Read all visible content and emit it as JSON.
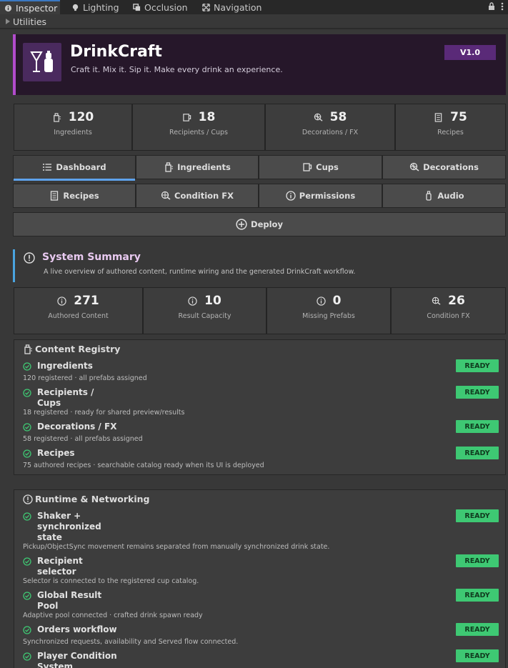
{
  "top_tabs": [
    {
      "label": "Inspector",
      "icon": "info-icon"
    },
    {
      "label": "Lighting",
      "icon": "bulb-icon"
    },
    {
      "label": "Occlusion",
      "icon": "occlusion-icon"
    },
    {
      "label": "Navigation",
      "icon": "navigation-icon"
    }
  ],
  "utilities_label": "Utilities",
  "app": {
    "title": "DrinkCraft",
    "tagline": "Craft it. Mix it. Sip it. Make every drink an experience.",
    "version": "V1.0",
    "accent": "#b24ccc"
  },
  "stats": [
    {
      "value": "120",
      "label": "Ingredients",
      "icon": "bottle-icon"
    },
    {
      "value": "18",
      "label": "Recipients / Cups",
      "icon": "cup-icon"
    },
    {
      "value": "58",
      "label": "Decorations / FX",
      "icon": "decoration-icon"
    },
    {
      "value": "75",
      "label": "Recipes",
      "icon": "recipe-icon"
    }
  ],
  "tabs_row1": [
    {
      "label": "Dashboard",
      "icon": "list-icon"
    },
    {
      "label": "Ingredients",
      "icon": "bottle-icon"
    },
    {
      "label": "Cups",
      "icon": "cup-icon"
    },
    {
      "label": "Decorations",
      "icon": "decoration-icon"
    }
  ],
  "tabs_row2": [
    {
      "label": "Recipes",
      "icon": "recipe-icon"
    },
    {
      "label": "Condition FX",
      "icon": "fx-icon"
    },
    {
      "label": "Permissions",
      "icon": "info-icon"
    },
    {
      "label": "Audio",
      "icon": "audio-icon"
    }
  ],
  "deploy_label": "Deploy",
  "summary": {
    "title": "System Summary",
    "subtitle": "A live overview of authored content, runtime wiring and the generated DrinkCraft workflow."
  },
  "summary_stats": [
    {
      "value": "271",
      "label": "Authored Content",
      "icon": "info-icon"
    },
    {
      "value": "10",
      "label": "Result Capacity",
      "icon": "info-icon"
    },
    {
      "value": "0",
      "label": "Missing Prefabs",
      "icon": "info-icon"
    },
    {
      "value": "26",
      "label": "Condition FX",
      "icon": "fx-icon"
    }
  ],
  "registry": {
    "title": "Content Registry",
    "items": [
      {
        "label1": "Ingredients",
        "label2": "",
        "desc": "120 registered · all prefabs assigned",
        "status": "READY"
      },
      {
        "label1": "Recipients /",
        "label2": "Cups",
        "desc": "18 registered · ready for shared preview/results",
        "status": "READY"
      },
      {
        "label1": "Decorations / FX",
        "label2": "",
        "desc": "58 registered · all prefabs assigned",
        "status": "READY"
      },
      {
        "label1": "Recipes",
        "label2": "",
        "desc": "75 authored recipes · searchable catalog ready when its UI is deployed",
        "status": "READY"
      }
    ]
  },
  "runtime": {
    "title": "Runtime & Networking",
    "items": [
      {
        "label1": "Shaker +",
        "label2": "synchronized",
        "label3": "state",
        "desc": "Pickup/ObjectSync movement remains separated from manually synchronized drink state.",
        "status": "READY"
      },
      {
        "label1": "Recipient",
        "label2": "selector",
        "label3": "",
        "desc": "Selector is connected to the registered cup catalog.",
        "status": "READY"
      },
      {
        "label1": "Global Result",
        "label2": "Pool",
        "label3": "",
        "desc": "Adaptive pool connected · crafted drink spawn ready",
        "status": "READY"
      },
      {
        "label1": "Orders workflow",
        "label2": "",
        "label3": "",
        "desc": "Synchronized requests, availability and Served flow connected.",
        "status": "READY"
      },
      {
        "label1": "Player Condition",
        "label2": "System",
        "label3": "",
        "desc": "",
        "status": "READY"
      }
    ]
  },
  "colors": {
    "ready": "#3ec873",
    "tab_active": "#5ea3ec",
    "summary_bar": "#4aa4e0"
  }
}
